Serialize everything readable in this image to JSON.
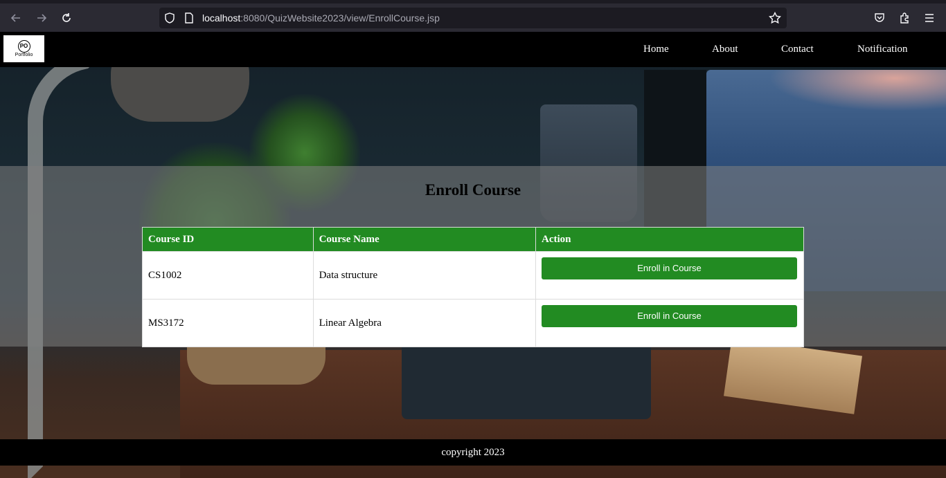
{
  "browser": {
    "url_host": "localhost",
    "url_rest": ":8080/QuizWebsite2023/view/EnrollCourse.jsp",
    "icons": [
      "back-arrow-icon",
      "forward-arrow-icon",
      "reload-icon",
      "shield-icon",
      "page-icon",
      "star-icon",
      "pocket-icon",
      "extensions-icon",
      "menu-icon"
    ]
  },
  "header": {
    "logo_mark": "PO",
    "logo_text": "Portfolio",
    "nav": [
      "Home",
      "About",
      "Contact",
      "Notification"
    ]
  },
  "main": {
    "title": "Enroll Course",
    "columns": [
      "Course ID",
      "Course Name",
      "Action"
    ],
    "rows": [
      {
        "id": "CS1002",
        "name": "Data structure",
        "action": "Enroll in Course"
      },
      {
        "id": "MS3172",
        "name": "Linear Algebra",
        "action": "Enroll in Course"
      }
    ]
  },
  "footer": {
    "text": "copyright 2023"
  },
  "colors": {
    "accent": "#228b22",
    "header_bg": "#000000",
    "panel_bg": "rgba(128,128,128,0.55)"
  }
}
